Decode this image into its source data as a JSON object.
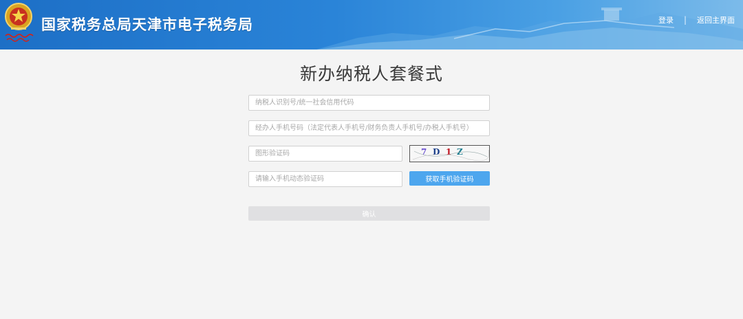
{
  "header": {
    "title": "国家税务总局天津市电子税务局",
    "login_label": "登录",
    "separator": "|",
    "home_label": "返回主界面",
    "logo_icon": "tax-emblem-icon"
  },
  "page": {
    "title": "新办纳税人套餐式"
  },
  "form": {
    "taxid": {
      "placeholder": "纳税人识别号/统一社会信用代码",
      "value": ""
    },
    "phone": {
      "placeholder": "经办人手机号码（法定代表人手机号/财务负责人手机号/办税人手机号）",
      "value": ""
    },
    "captcha": {
      "placeholder": "图形验证码",
      "value": ""
    },
    "captcha_image_text": "7D1Z",
    "smscode": {
      "placeholder": "请输入手机动态验证码",
      "value": ""
    },
    "sms_button_label": "获取手机验证码",
    "confirm_label": "确认"
  },
  "colors": {
    "header_blue": "#2a84d8",
    "sms_button": "#4da6ee",
    "confirm_disabled": "#e0e0e2",
    "background": "#f4f4f4"
  }
}
